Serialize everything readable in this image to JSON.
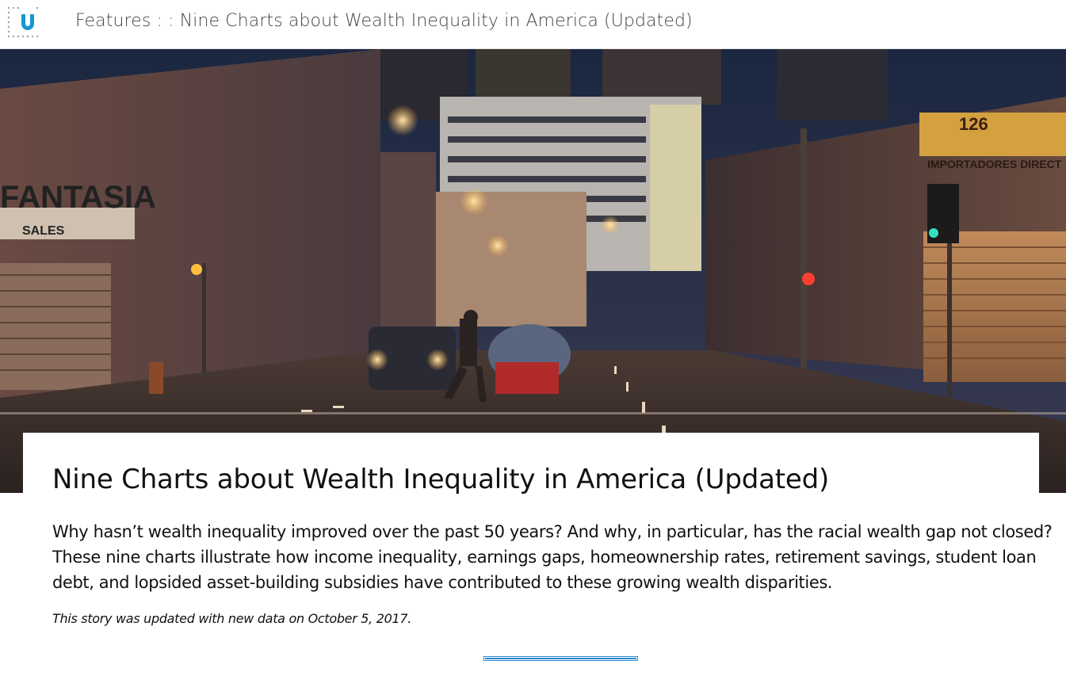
{
  "header": {
    "section_label": "Features",
    "separator": ": :",
    "article_title": "Nine Charts about Wealth Inequality in America (Updated)",
    "logo_icon": "urban-institute-u-logo-icon",
    "brand_color": "#1696d2"
  },
  "hero": {
    "image_description_icon": "street-scene-photo"
  },
  "article": {
    "title": "Nine Charts about Wealth Inequality in America (Updated)",
    "lede": "Why hasn’t wealth inequality improved over the past 50 years? And why, in particular, has the racial wealth gap not closed? These nine charts illustrate how income inequality, earnings gaps, homeownership rates, retirement savings, student loan debt, and lopsided asset-building subsidies have contributed to these growing wealth disparities.",
    "update_note": "This story was updated with new data on October 5, 2017.",
    "accent_color": "#2b8ad4"
  },
  "hero_photo": {
    "sign_fantasia": "FANTASIA",
    "sign_sales": "SALES",
    "sign_number": "126",
    "sign_importadores": "IMPORTADORES DIRECT"
  }
}
